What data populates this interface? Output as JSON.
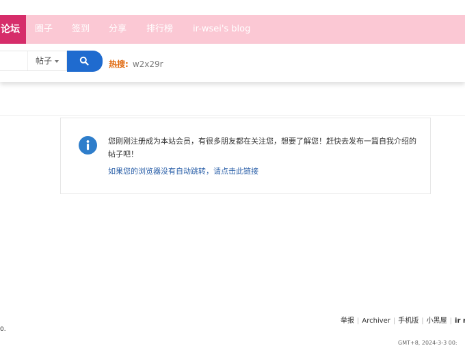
{
  "nav": {
    "active": "论坛",
    "items": [
      "圈子",
      "签到",
      "分享",
      "排行榜",
      "ir-wsei's blog"
    ]
  },
  "search": {
    "type_label": "帖子",
    "button_icon": "search-icon",
    "hot_label": "热搜:",
    "hot_keyword": "w2x29r"
  },
  "message": {
    "icon": "info-icon",
    "text": "您刚刚注册成为本站会员，有很多朋友都在关注您，想要了解您！赶快去发布一篇自我介绍的帖子吧！",
    "link": "如果您的浏览器没有自动跳转，请点击此链接"
  },
  "footer": {
    "links": [
      "举报",
      "Archiver",
      "手机版",
      "小黑屋",
      "ir re"
    ],
    "left_fragment": "0.",
    "time": "GMT+8, 2024-3-3 00:"
  },
  "colors": {
    "nav_bg": "#fbc8d4",
    "nav_active": "#d62d6a",
    "search_button": "#1f6bcf",
    "info_icon": "#2f7ecb",
    "hot_label": "#e06a10",
    "link": "#2a5fa8"
  }
}
